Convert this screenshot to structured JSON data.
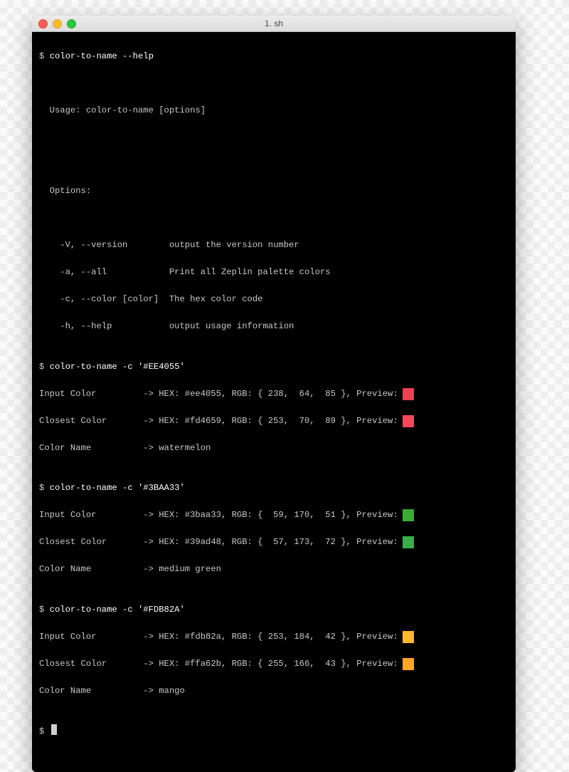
{
  "window": {
    "title": "1. sh"
  },
  "prompt": "$",
  "help_cmd": "color-to-name --help",
  "usage": "  Usage: color-to-name [options]",
  "options_header": "  Options:",
  "options": {
    "version": "    -V, --version        output the version number",
    "all": "    -a, --all            Print all Zeplin palette colors",
    "color": "    -c, --color [color]  The hex color code",
    "help": "    -h, --help           output usage information"
  },
  "runs": [
    {
      "cmd": "color-to-name -c '#EE4055'",
      "input": {
        "text": "Input Color         -> HEX: #ee4055, RGB: { 238,  64,  85 }, Preview:",
        "swatch": "#ee4055"
      },
      "closest": {
        "text": "Closest Color       -> HEX: #fd4659, RGB: { 253,  70,  89 }, Preview:",
        "swatch": "#fd4659"
      },
      "name": "Color Name          -> watermelon"
    },
    {
      "cmd": "color-to-name -c '#3BAA33'",
      "input": {
        "text": "Input Color         -> HEX: #3baa33, RGB: {  59, 170,  51 }, Preview:",
        "swatch": "#3baa33"
      },
      "closest": {
        "text": "Closest Color       -> HEX: #39ad48, RGB: {  57, 173,  72 }, Preview:",
        "swatch": "#39ad48"
      },
      "name": "Color Name          -> medium green"
    },
    {
      "cmd": "color-to-name -c '#FDB82A'",
      "input": {
        "text": "Input Color         -> HEX: #fdb82a, RGB: { 253, 184,  42 }, Preview:",
        "swatch": "#fdb82a"
      },
      "closest": {
        "text": "Closest Color       -> HEX: #ffa62b, RGB: { 255, 166,  43 }, Preview:",
        "swatch": "#ffa62b"
      },
      "name": "Color Name          -> mango"
    }
  ]
}
